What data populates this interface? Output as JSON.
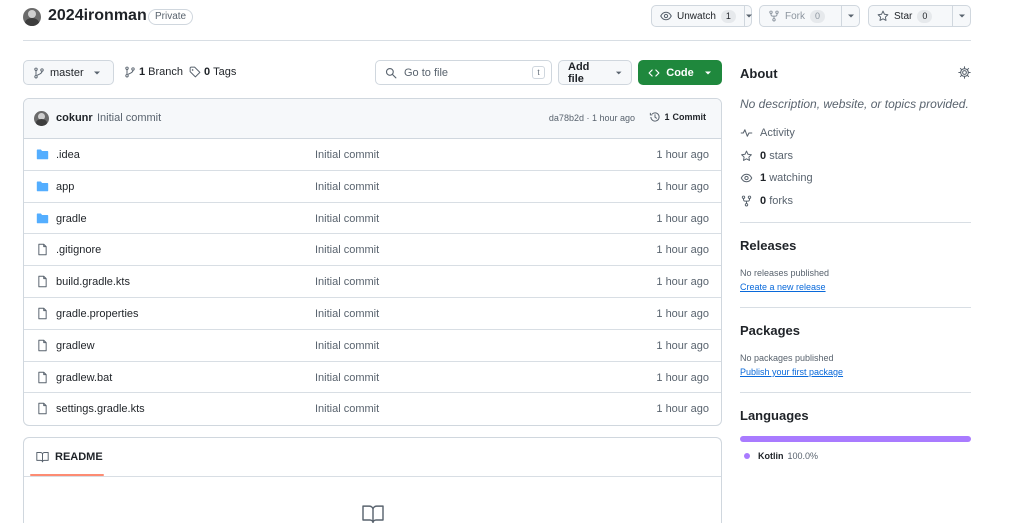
{
  "repo": {
    "name": "2024ironman",
    "visibility": "Private"
  },
  "header_actions": {
    "watch": {
      "label": "Unwatch",
      "count": "1"
    },
    "fork": {
      "label": "Fork",
      "count": "0"
    },
    "star": {
      "label": "Star",
      "count": "0"
    }
  },
  "toolbar": {
    "branch": "master",
    "branches_count": "1",
    "branches_label": "Branch",
    "tags_count": "0",
    "tags_label": "Tags",
    "search_placeholder": "Go to file",
    "search_shortcut": "t",
    "add_file": "Add file",
    "code": "Code"
  },
  "latest_commit": {
    "author": "cokunr",
    "message": "Initial commit",
    "meta": "da78b2d · 1 hour ago",
    "count": "1",
    "count_label": "Commit"
  },
  "files": [
    {
      "name": ".idea",
      "type": "folder",
      "message": "Initial commit",
      "time": "1 hour ago"
    },
    {
      "name": "app",
      "type": "folder",
      "message": "Initial commit",
      "time": "1 hour ago"
    },
    {
      "name": "gradle",
      "type": "folder",
      "message": "Initial commit",
      "time": "1 hour ago"
    },
    {
      "name": ".gitignore",
      "type": "file",
      "message": "Initial commit",
      "time": "1 hour ago"
    },
    {
      "name": "build.gradle.kts",
      "type": "file",
      "message": "Initial commit",
      "time": "1 hour ago"
    },
    {
      "name": "gradle.properties",
      "type": "file",
      "message": "Initial commit",
      "time": "1 hour ago"
    },
    {
      "name": "gradlew",
      "type": "file",
      "message": "Initial commit",
      "time": "1 hour ago"
    },
    {
      "name": "gradlew.bat",
      "type": "file",
      "message": "Initial commit",
      "time": "1 hour ago"
    },
    {
      "name": "settings.gradle.kts",
      "type": "file",
      "message": "Initial commit",
      "time": "1 hour ago"
    }
  ],
  "readme": {
    "tab_label": "README"
  },
  "sidebar": {
    "about_title": "About",
    "description": "No description, website, or topics provided.",
    "activity": "Activity",
    "stars_count": "0",
    "stars_label": "stars",
    "watching_count": "1",
    "watching_label": "watching",
    "forks_count": "0",
    "forks_label": "forks",
    "releases_title": "Releases",
    "releases_empty": "No releases published",
    "releases_link": "Create a new release",
    "packages_title": "Packages",
    "packages_empty": "No packages published",
    "packages_link": "Publish your first package",
    "languages_title": "Languages",
    "languages": [
      {
        "name": "Kotlin",
        "percent": "100.0%",
        "share": 100,
        "color": "#a97bff"
      }
    ]
  },
  "colors": {
    "accent_green": "#1f883d",
    "link_blue": "#0969da",
    "folder_blue": "#54aeff",
    "kotlin": "#a97bff"
  }
}
